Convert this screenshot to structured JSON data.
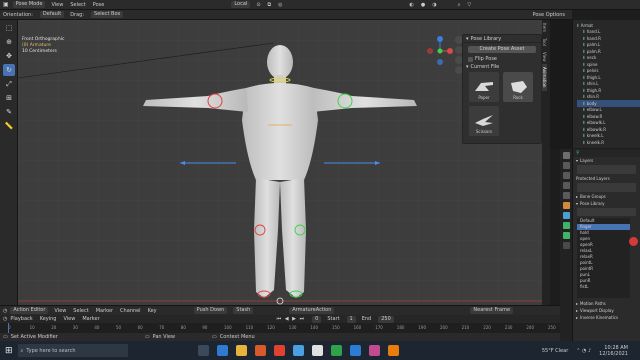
{
  "header": {
    "mode": "Pose Mode",
    "menus": [
      "View",
      "Select",
      "Pose"
    ],
    "orientation": "Local",
    "orientation_label": "Orientation:",
    "transform_default": "Default",
    "drag_label": "Drag:",
    "drag_value": "Select Box",
    "pose_options": "Pose Options"
  },
  "viewport": {
    "view_name": "Front Orthographic",
    "object_name": "(0) Armature",
    "scale": "10 Centimeters"
  },
  "pose_library_panel": {
    "title": "Pose Library",
    "create_button": "Create Pose Asset",
    "flip_label": "Flip Pose",
    "catalog": "Current File",
    "poses": [
      {
        "label": "Paper"
      },
      {
        "label": "Rock"
      },
      {
        "label": "Scissors"
      }
    ]
  },
  "side_tabs": [
    "Item",
    "Tool",
    "View",
    "Animation"
  ],
  "outliner": {
    "items": [
      "Armat",
      "hand.L",
      "hand.R",
      "palm.L",
      "palm.R",
      "neck",
      "spine",
      "pelvis",
      "thigh.L",
      "shin.L",
      "thigh.R",
      "shin.R",
      "body",
      "elbow.L",
      "elbow.R",
      "elbowlk.L",
      "elbowlk.R",
      "kneelk.L",
      "kneelk.R"
    ]
  },
  "properties": {
    "layers_label": "Layers",
    "protected_layers_label": "Protected Layers",
    "bone_groups_label": "Bone Groups",
    "pose_library_label": "Pose Library",
    "slots": [
      "Default",
      "finger",
      "hold",
      "open",
      "openR",
      "relaxL",
      "relaxR",
      "pointL",
      "pointR",
      "punL",
      "punR",
      "fistL"
    ],
    "motion_paths_label": "Motion Paths",
    "viewport_display_label": "Viewport Display",
    "inverse_kinematics_label": "Inverse Kinematics"
  },
  "timeline": {
    "editor": "Action Editor",
    "menus": [
      "View",
      "Select",
      "Marker",
      "Channel",
      "Key"
    ],
    "push_down": "Push Down",
    "stash": "Stash",
    "action_name": "ArmatureAction",
    "nearest_frame": "Nearest Frame",
    "playback": "Playback",
    "keying": "Keying",
    "view": "View",
    "marker": "Marker",
    "frame_current": "0",
    "start_label": "Start",
    "start": "1",
    "end_label": "End",
    "end": "250",
    "ruler": [
      "0",
      "10",
      "20",
      "30",
      "40",
      "50",
      "60",
      "70",
      "80",
      "90",
      "100",
      "110",
      "120",
      "130",
      "140",
      "150",
      "160",
      "170",
      "180",
      "190",
      "200",
      "210",
      "220",
      "230",
      "240",
      "250"
    ]
  },
  "statusbar": {
    "left": "Set Active Modifier",
    "middle": "Pan View",
    "right": "Context Menu"
  },
  "taskbar": {
    "search_placeholder": "Type here to search",
    "weather": "55°F Clear",
    "time": "10:28 AM",
    "date": "12/16/2021"
  },
  "colors": {
    "accent": "#4772b3",
    "viewport_bg": "#3d3d3d",
    "bone_green": "#3ed24a",
    "bone_red": "#e04040",
    "bone_yellow": "#e8d13a",
    "gizmo_blue": "#4a8ff0"
  }
}
